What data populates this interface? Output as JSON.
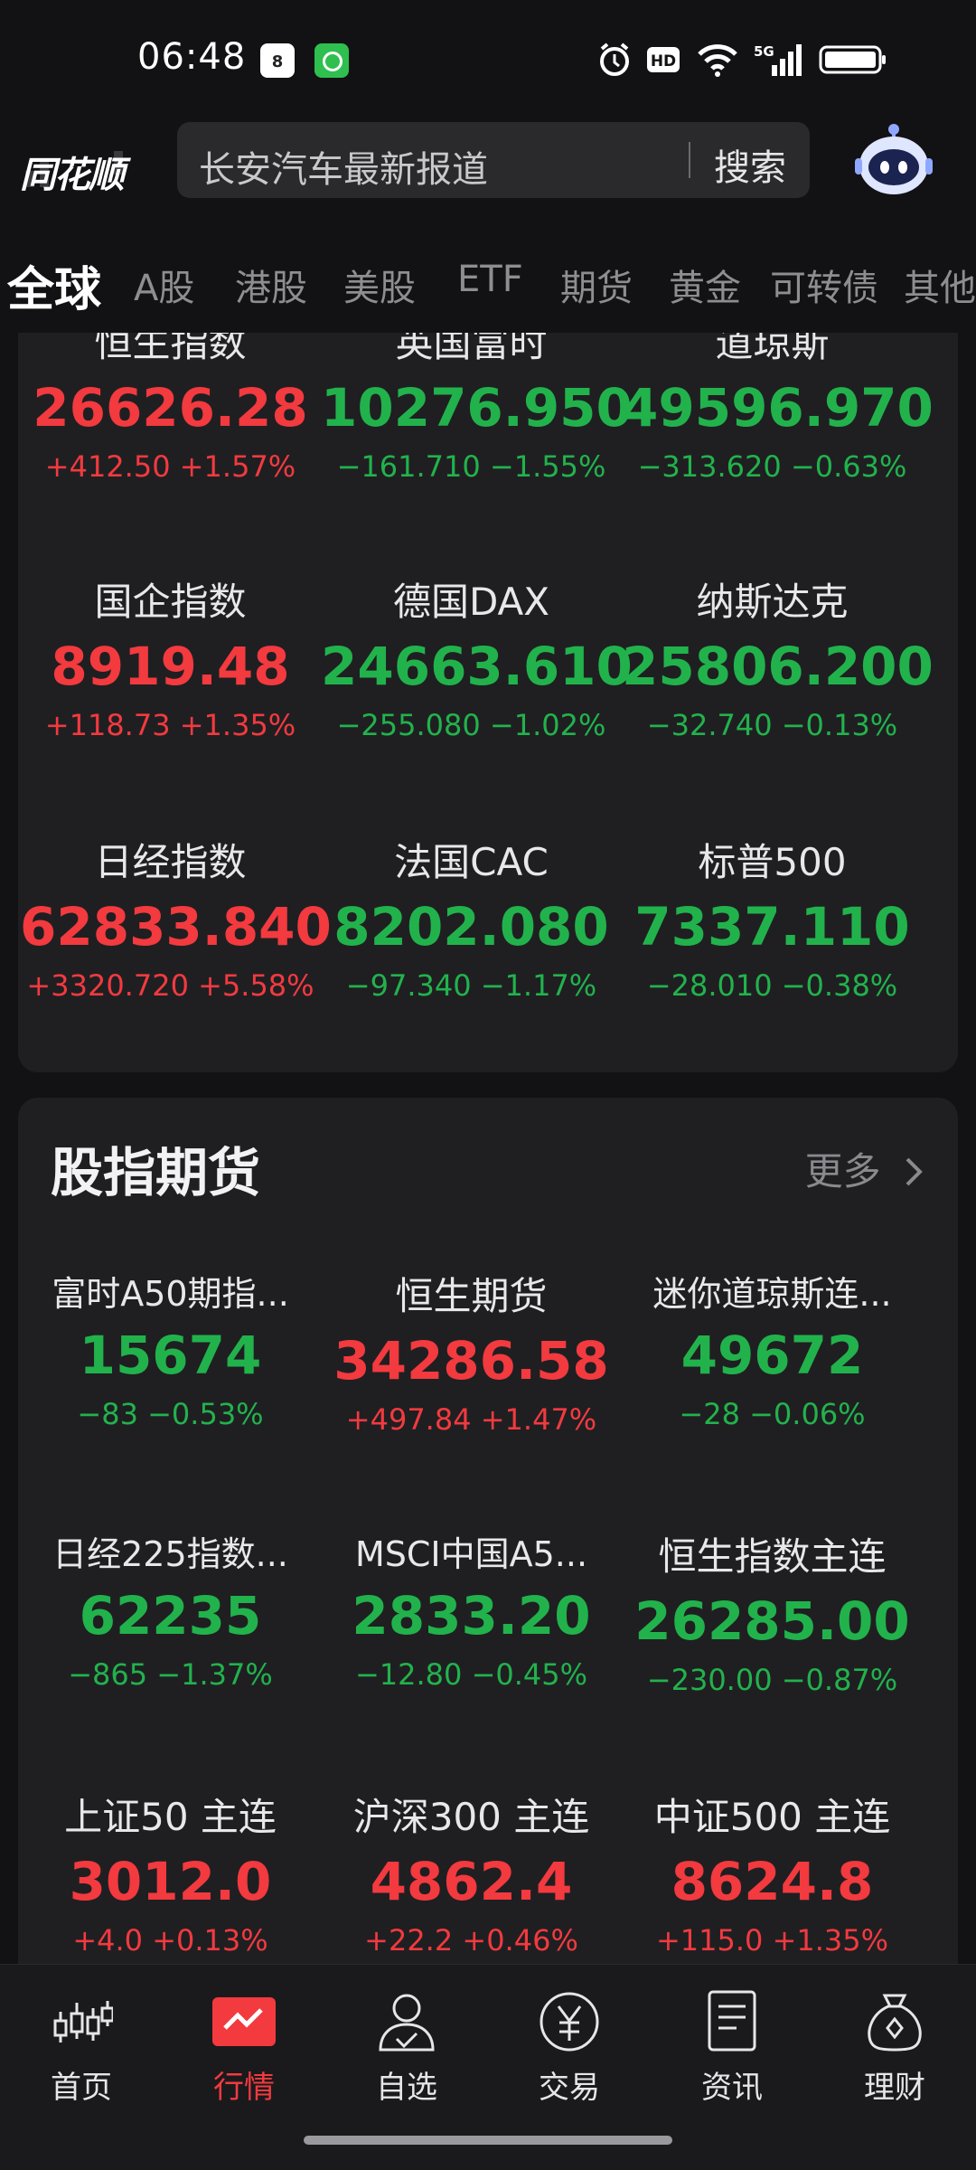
{
  "status_bar": {
    "time": "06:48",
    "calendar_day": "8",
    "network": "5G"
  },
  "header": {
    "logo_text": "同花顺",
    "search_placeholder": "长安汽车最新报道",
    "search_button": "搜索"
  },
  "tabs": [
    {
      "label": "全球",
      "active": true
    },
    {
      "label": "A股"
    },
    {
      "label": "港股"
    },
    {
      "label": "美股"
    },
    {
      "label": "ETF"
    },
    {
      "label": "期货"
    },
    {
      "label": "黄金"
    },
    {
      "label": "可转债"
    },
    {
      "label": "其他"
    }
  ],
  "global_indices": [
    {
      "name": "恒生指数",
      "price": "26626.28",
      "change": "+412.50 +1.57%",
      "trend": "up"
    },
    {
      "name": "英国富时",
      "price": "10276.950",
      "change": "−161.710 −1.55%",
      "trend": "down"
    },
    {
      "name": "道琼斯",
      "price": "49596.970",
      "change": "−313.620 −0.63%",
      "trend": "down"
    },
    {
      "name": "国企指数",
      "price": "8919.48",
      "change": "+118.73 +1.35%",
      "trend": "up"
    },
    {
      "name": "德国DAX",
      "price": "24663.610",
      "change": "−255.080 −1.02%",
      "trend": "down"
    },
    {
      "name": "纳斯达克",
      "price": "25806.200",
      "change": "−32.740 −0.13%",
      "trend": "down"
    },
    {
      "name": "日经指数",
      "price": "62833.840",
      "change": "+3320.720 +5.58%",
      "trend": "up"
    },
    {
      "name": "法国CAC",
      "price": "8202.080",
      "change": "−97.340 −1.17%",
      "trend": "down"
    },
    {
      "name": "标普500",
      "price": "7337.110",
      "change": "−28.010 −0.38%",
      "trend": "down"
    }
  ],
  "futures_section": {
    "title": "股指期货",
    "more": "更多",
    "items": [
      {
        "name": "富时A50期指...",
        "price": "15674",
        "change": "−83 −0.53%",
        "trend": "down"
      },
      {
        "name": "恒生期货",
        "price": "34286.58",
        "change": "+497.84 +1.47%",
        "trend": "up"
      },
      {
        "name": "迷你道琼斯连...",
        "price": "49672",
        "change": "−28 −0.06%",
        "trend": "down"
      },
      {
        "name": "日经225指数...",
        "price": "62235",
        "change": "−865 −1.37%",
        "trend": "down"
      },
      {
        "name": "MSCI中国A5...",
        "price": "2833.20",
        "change": "−12.80 −0.45%",
        "trend": "down"
      },
      {
        "name": "恒生指数主连",
        "price": "26285.00",
        "change": "−230.00 −0.87%",
        "trend": "down"
      },
      {
        "name": "上证50 主连",
        "price": "3012.0",
        "change": "+4.0 +0.13%",
        "trend": "up"
      },
      {
        "name": "沪深300 主连",
        "price": "4862.4",
        "change": "+22.2 +0.46%",
        "trend": "up"
      },
      {
        "name": "中证500 主连",
        "price": "8624.8",
        "change": "+115.0 +1.35%",
        "trend": "up"
      }
    ]
  },
  "bottom_nav": [
    {
      "label": "首页",
      "icon": "candlestick-icon"
    },
    {
      "label": "行情",
      "icon": "market-chart-icon",
      "active": true
    },
    {
      "label": "自选",
      "icon": "user-check-icon"
    },
    {
      "label": "交易",
      "icon": "yuan-coin-icon"
    },
    {
      "label": "资讯",
      "icon": "document-icon"
    },
    {
      "label": "理财",
      "icon": "money-bag-icon"
    }
  ],
  "colors": {
    "up": "#f23a3f",
    "down": "#22b24c",
    "background": "#121214",
    "card": "#1f1f22"
  }
}
